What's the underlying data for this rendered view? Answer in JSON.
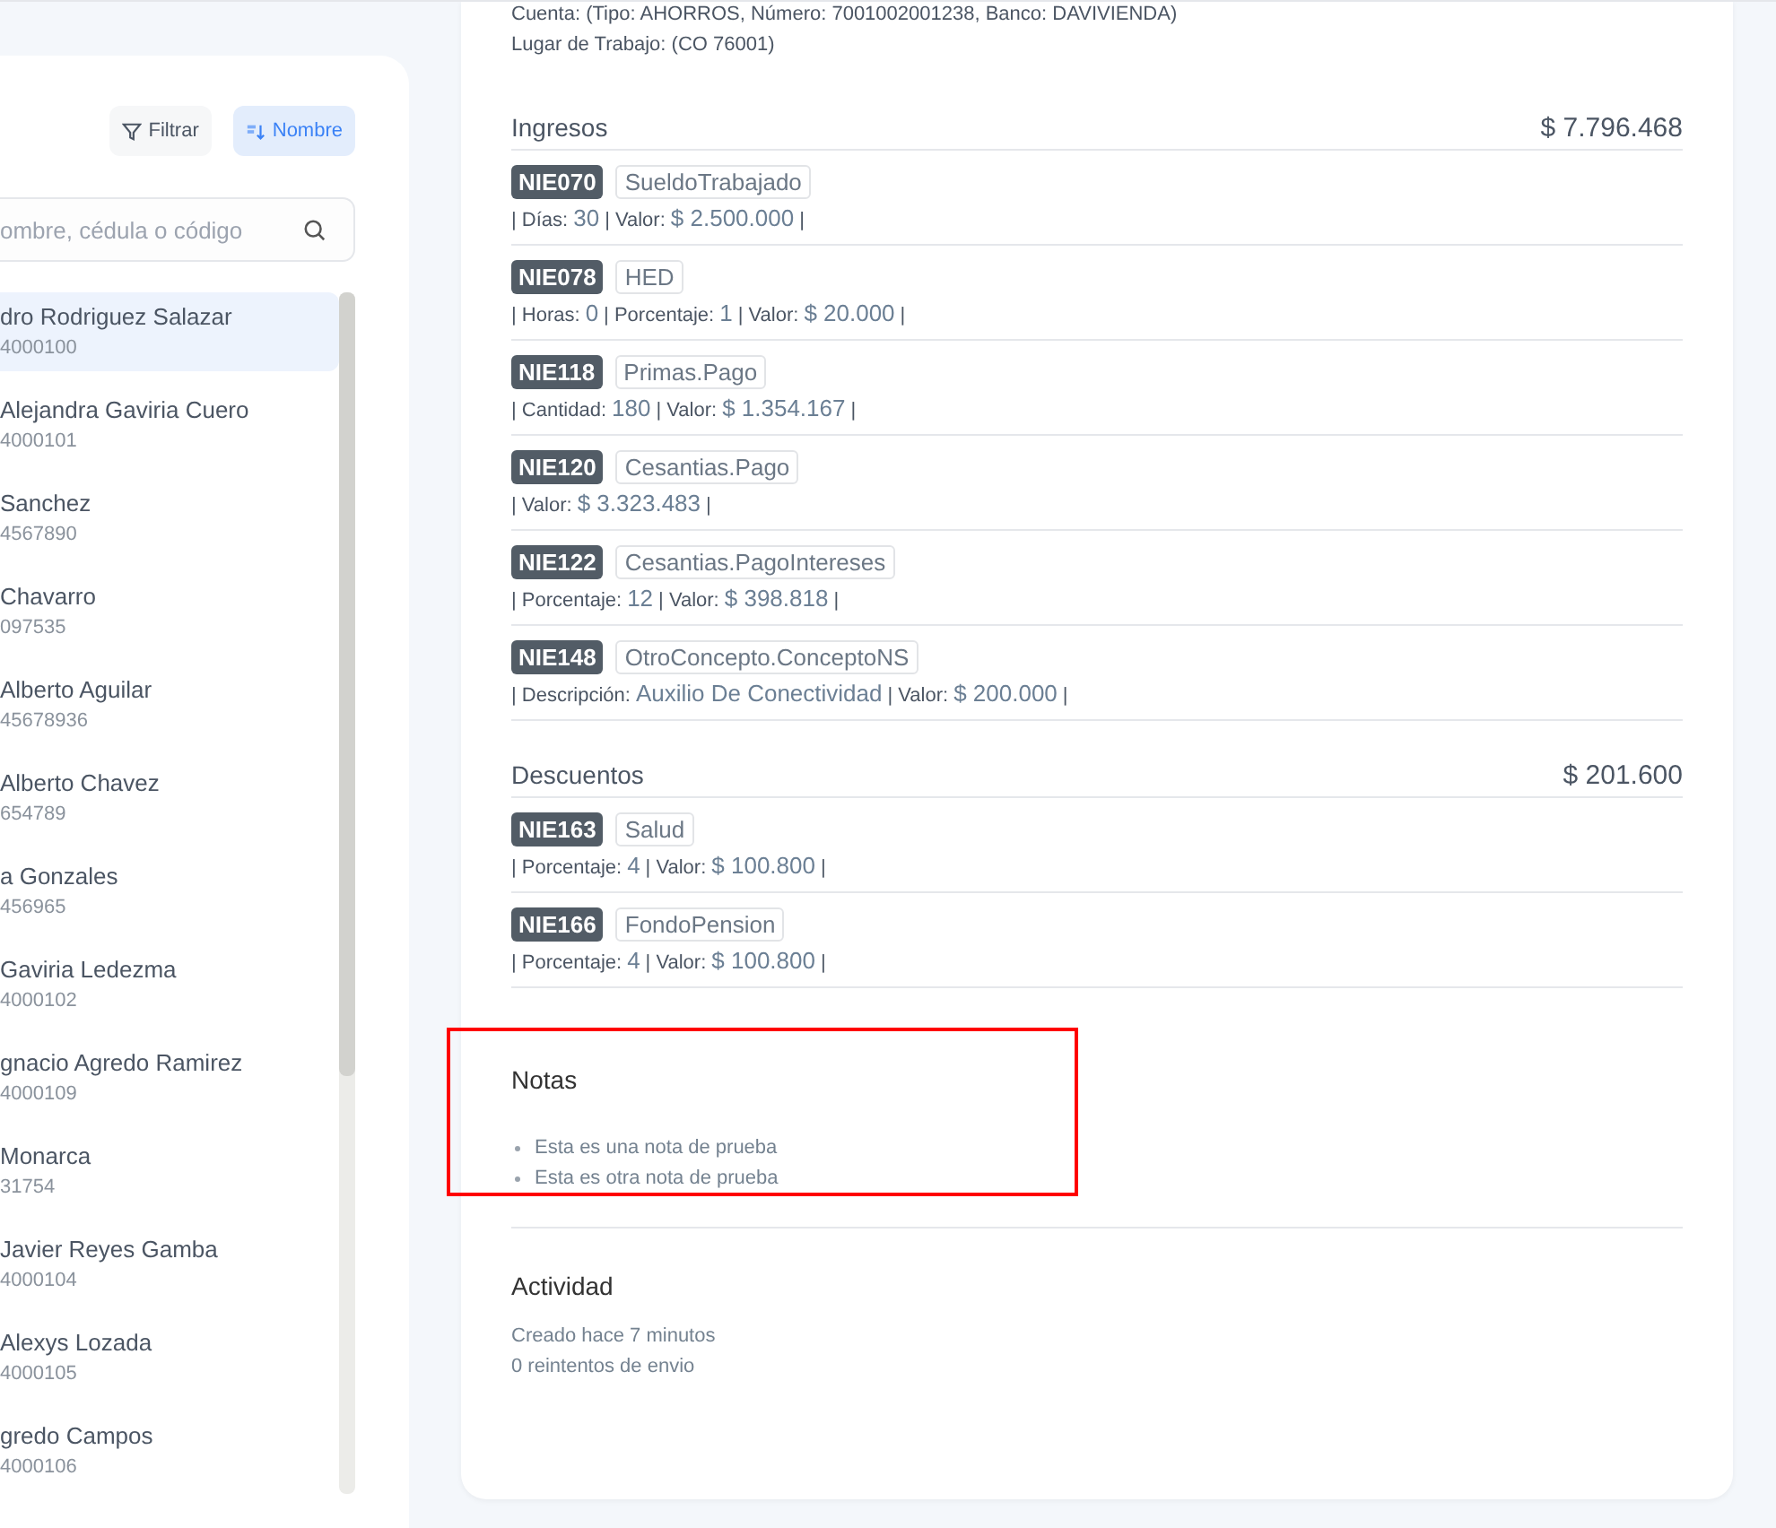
{
  "sidebar": {
    "buttons": [
      {
        "label": "Filtrar",
        "kind": "filter",
        "selected": false
      },
      {
        "label": "Nombre",
        "kind": "sort",
        "selected": true
      }
    ],
    "search": {
      "placeholder": "ombre, cédula o código"
    },
    "employees": [
      {
        "name": "dro Rodriguez Salazar",
        "code": "4000100",
        "selected": true
      },
      {
        "name": "Alejandra Gaviria Cuero",
        "code": "4000101",
        "selected": false
      },
      {
        "name": "Sanchez",
        "code": "4567890",
        "selected": false
      },
      {
        "name": "Chavarro",
        "code": "097535",
        "selected": false
      },
      {
        "name": "Alberto Aguilar",
        "code": "45678936",
        "selected": false
      },
      {
        "name": "Alberto Chavez",
        "code": "654789",
        "selected": false
      },
      {
        "name": "a Gonzales",
        "code": "456965",
        "selected": false
      },
      {
        "name": "Gaviria Ledezma",
        "code": "4000102",
        "selected": false
      },
      {
        "name": "gnacio Agredo Ramirez",
        "code": "4000109",
        "selected": false
      },
      {
        "name": "Monarca",
        "code": "31754",
        "selected": false
      },
      {
        "name": "Javier Reyes Gamba",
        "code": "4000104",
        "selected": false
      },
      {
        "name": "Alexys Lozada",
        "code": "4000105",
        "selected": false
      },
      {
        "name": "gredo Campos",
        "code": "4000106",
        "selected": false
      }
    ]
  },
  "detail": {
    "info_lines": [
      "Cuenta: (Tipo: AHORROS, Número: 7001002001238, Banco: DAVIVIENDA)",
      "Lugar de Trabajo: (CO 76001)"
    ],
    "sections": [
      {
        "title": "Ingresos",
        "total": "$ 7.796.468",
        "concepts": [
          {
            "code": "NIE070",
            "name": "SueldoTrabajado",
            "fields": [
              {
                "label": "| Días:",
                "value": "30"
              },
              {
                "label": "| Valor:",
                "value": "$ 2.500.000"
              }
            ],
            "end": "|"
          },
          {
            "code": "NIE078",
            "name": "HED",
            "fields": [
              {
                "label": "| Horas:",
                "value": "0"
              },
              {
                "label": "| Porcentaje:",
                "value": "1"
              },
              {
                "label": "| Valor:",
                "value": "$ 20.000"
              }
            ],
            "end": "|"
          },
          {
            "code": "NIE118",
            "name": "Primas.Pago",
            "fields": [
              {
                "label": "| Cantidad:",
                "value": "180"
              },
              {
                "label": "| Valor:",
                "value": "$ 1.354.167"
              }
            ],
            "end": "|"
          },
          {
            "code": "NIE120",
            "name": "Cesantias.Pago",
            "fields": [
              {
                "label": "| Valor:",
                "value": "$ 3.323.483"
              }
            ],
            "end": "|"
          },
          {
            "code": "NIE122",
            "name": "Cesantias.PagoIntereses",
            "fields": [
              {
                "label": "| Porcentaje:",
                "value": "12"
              },
              {
                "label": "| Valor:",
                "value": "$ 398.818"
              }
            ],
            "end": "|"
          },
          {
            "code": "NIE148",
            "name": "OtroConcepto.ConceptoNS",
            "fields": [
              {
                "label": "| Descripción:",
                "value": "Auxilio De Conectividad"
              },
              {
                "label": "| Valor:",
                "value": "$ 200.000"
              }
            ],
            "end": "|"
          }
        ]
      },
      {
        "title": "Descuentos",
        "total": "$ 201.600",
        "concepts": [
          {
            "code": "NIE163",
            "name": "Salud",
            "fields": [
              {
                "label": "| Porcentaje:",
                "value": "4"
              },
              {
                "label": "| Valor:",
                "value": "$ 100.800"
              }
            ],
            "end": "|"
          },
          {
            "code": "NIE166",
            "name": "FondoPension",
            "fields": [
              {
                "label": "| Porcentaje:",
                "value": "4"
              },
              {
                "label": "| Valor:",
                "value": "$ 100.800"
              }
            ],
            "end": "|"
          }
        ]
      }
    ],
    "notes": {
      "title": "Notas",
      "highlighted": true,
      "items": [
        "Esta es una nota de prueba",
        "Esta es otra nota de prueba"
      ]
    },
    "activity": {
      "title": "Actividad",
      "lines": [
        "Creado hace 7 minutos",
        "0 reintentos de envio"
      ]
    }
  }
}
